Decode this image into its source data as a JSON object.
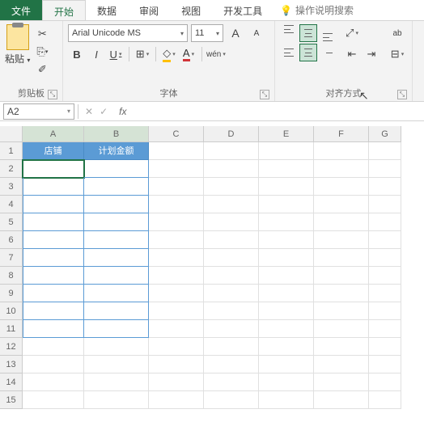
{
  "tabs": {
    "file": "文件",
    "home": "开始",
    "data": "数据",
    "review": "审阅",
    "view": "视图",
    "dev": "开发工具",
    "tell": "操作说明搜索"
  },
  "ribbon": {
    "clipboard": {
      "paste": "粘贴",
      "label": "剪贴板"
    },
    "font": {
      "name": "Arial Unicode MS",
      "size": "11",
      "increase": "A",
      "decrease": "A",
      "bold": "B",
      "italic": "I",
      "underline": "U",
      "ruby": "wén",
      "label": "字体"
    },
    "align": {
      "wrap": "ab",
      "label": "对齐方式"
    }
  },
  "namebox": {
    "ref": "A2",
    "fx": "fx"
  },
  "grid": {
    "cols": [
      "A",
      "B",
      "C",
      "D",
      "E",
      "F",
      "G"
    ],
    "rows": [
      "1",
      "2",
      "3",
      "4",
      "5",
      "6",
      "7",
      "8",
      "9",
      "10",
      "11",
      "12",
      "13",
      "14",
      "15"
    ],
    "headers": {
      "A1": "店铺",
      "B1": "计划金额"
    },
    "active": "A2"
  }
}
